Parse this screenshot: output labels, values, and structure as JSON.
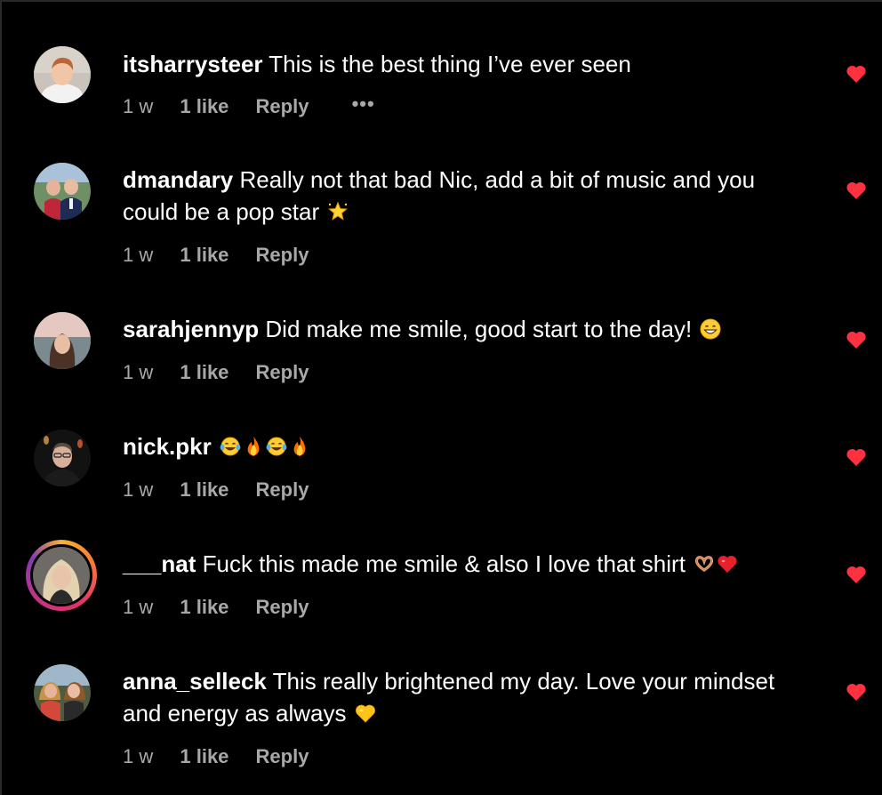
{
  "colors": {
    "background": "#000000",
    "text": "#ffffff",
    "meta_text": "#a8a8a8",
    "heart": "#ff3040"
  },
  "comments": [
    {
      "username": "itsharrysteer",
      "text": " This is the best thing I’ve ever seen",
      "emojis": [],
      "time": "1 w",
      "likes": "1 like",
      "reply": "Reply",
      "more": "•••",
      "liked_icon": "heart-icon"
    },
    {
      "username": "dmandary",
      "text": " Really not that bad Nic, add a bit of music and you could be a pop star",
      "emojis": [
        "glowing-star-emoji"
      ],
      "time": "1 w",
      "likes": "1 like",
      "reply": "Reply",
      "liked_icon": "heart-icon"
    },
    {
      "username": "sarahjennyp",
      "text": " Did make me smile, good start to the day!",
      "emojis": [
        "grinning-face-emoji"
      ],
      "time": "1 w",
      "likes": "1 like",
      "reply": "Reply",
      "liked_icon": "heart-icon"
    },
    {
      "username": "nick.pkr",
      "text": "",
      "emojis": [
        "tears-of-joy-emoji",
        "fire-emoji",
        "tears-of-joy-emoji",
        "fire-emoji"
      ],
      "time": "1 w",
      "likes": "1 like",
      "reply": "Reply",
      "liked_icon": "heart-icon"
    },
    {
      "username": "___nat",
      "text": " Fuck this made me smile & also I love that shirt",
      "emojis": [
        "heart-hands-emoji",
        "red-heart-emoji"
      ],
      "time": "1 w",
      "likes": "1 like",
      "reply": "Reply",
      "liked_icon": "heart-icon"
    },
    {
      "username": "anna_selleck",
      "text": " This really brightened my day. Love your mindset and energy as always",
      "emojis": [
        "yellow-heart-emoji"
      ],
      "time": "1 w",
      "likes": "1 like",
      "reply": "Reply",
      "liked_icon": "heart-icon"
    }
  ]
}
